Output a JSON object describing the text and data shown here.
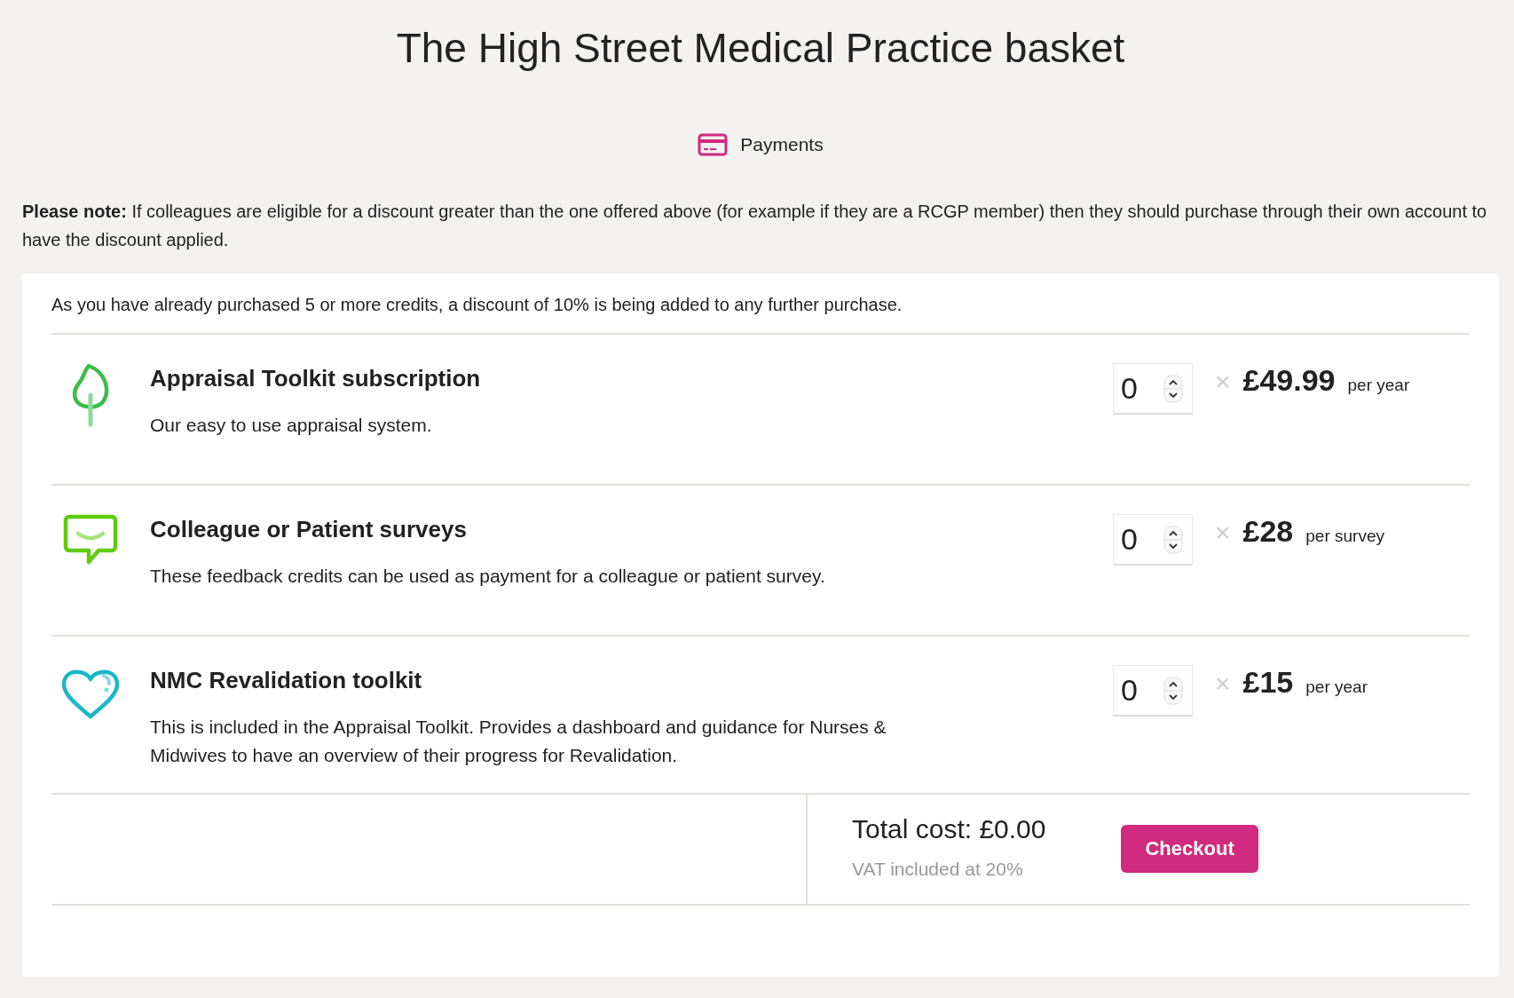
{
  "page_title": "The High Street Medical Practice basket",
  "payments_link": "Payments",
  "note": "**Please note:** If colleagues are eligible for a discount greater than the one offered above (for example if they are a RCGP member) then they should purchase through their own account to have the discount applied.",
  "discount_message": "As you have already purchased 5 or more credits, a discount of 10% is being added to any further purchase.",
  "products": [
    {
      "name": "Appraisal Toolkit subscription",
      "description": "Our easy to use appraisal system.",
      "quantity": "0",
      "times": "×",
      "price": "£49.99",
      "unit": "per year"
    },
    {
      "name": "Colleague or Patient surveys",
      "description": "These feedback credits can be used as payment for a colleague or patient survey.",
      "quantity": "0",
      "times": "×",
      "price": "£28",
      "unit": "per survey"
    },
    {
      "name": "NMC Revalidation toolkit",
      "description": "This is included in the Appraisal Toolkit. Provides a dashboard and guidance for Nurses & Midwives to have an overview of their progress for Revalidation.",
      "quantity": "0",
      "times": "×",
      "price": "£15",
      "unit": "per year"
    }
  ],
  "total": {
    "label": "Total cost: £0.00",
    "vat": "VAT included at 20%"
  },
  "checkout_button": "Checkout"
}
